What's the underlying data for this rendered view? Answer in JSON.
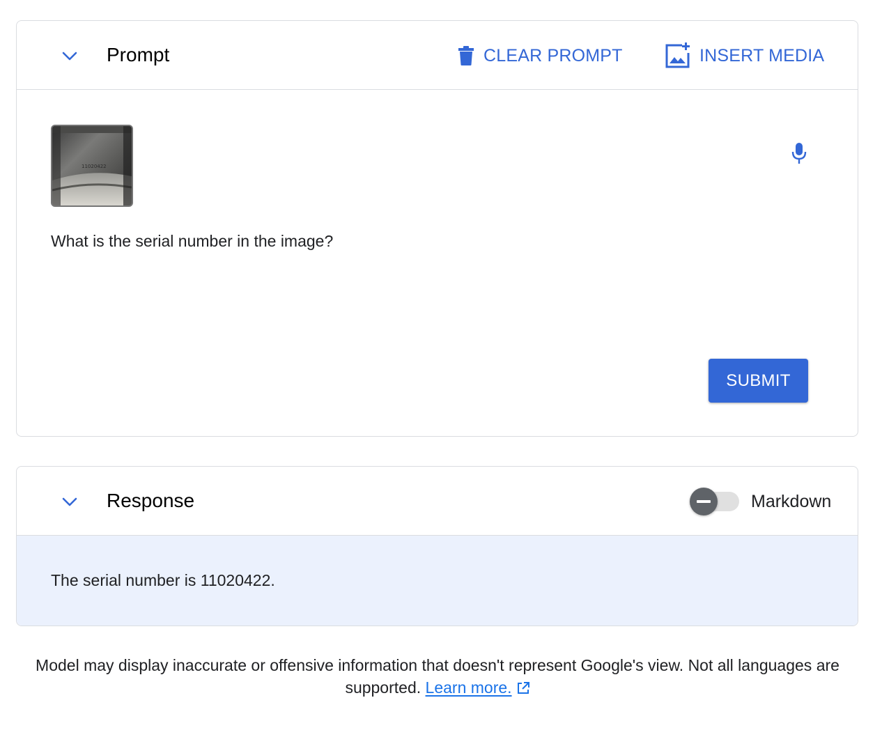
{
  "prompt_panel": {
    "title": "Prompt",
    "collapse_icon": "chevron-down-icon",
    "clear_label": "CLEAR PROMPT",
    "clear_icon": "trash-icon",
    "insert_label": "INSERT MEDIA",
    "insert_icon": "add-photo-icon",
    "attachment": {
      "kind": "image",
      "label_on_image": "11020422"
    },
    "mic_icon": "microphone-icon",
    "prompt_text": "What is the serial number in the image?",
    "submit_label": "SUBMIT"
  },
  "response_panel": {
    "title": "Response",
    "collapse_icon": "chevron-down-icon",
    "markdown_toggle": {
      "label": "Markdown",
      "enabled": false
    },
    "response_text": "The serial number is 11020422."
  },
  "footer": {
    "disclaimer_line1": "Model may display inaccurate or offensive information that doesn't represent Google's view. Not all languages are",
    "disclaimer_line2": "supported.",
    "learn_more": "Learn more.",
    "external_link_icon": "open-in-new-icon"
  },
  "colors": {
    "accent": "#3367d6",
    "link": "#1a73e8",
    "response_bg": "#ebf1fd",
    "border": "#dadce0",
    "toggle_thumb": "#5f6368"
  }
}
